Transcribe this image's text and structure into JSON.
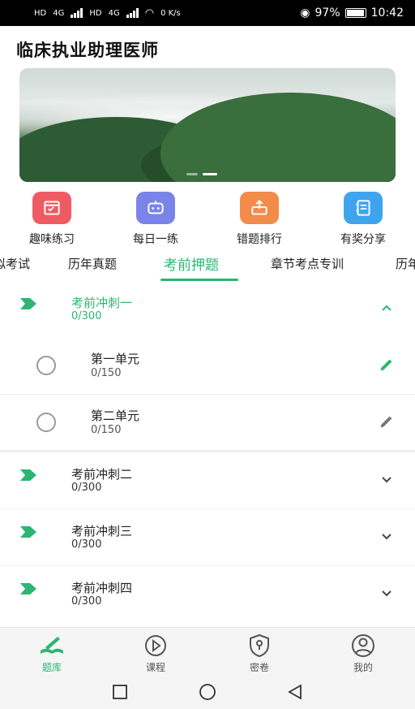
{
  "status": {
    "left": [
      "HD",
      "4G",
      "HD",
      "4G",
      "0 K/s"
    ],
    "battery": "97%",
    "time": "10:42"
  },
  "app_title": "临床执业助理医师",
  "quick": [
    {
      "label": "趣味练习",
      "icon": "calendar-icon",
      "color": "#ef5b63"
    },
    {
      "label": "每日一练",
      "icon": "robot-icon",
      "color": "#7a84e8"
    },
    {
      "label": "错题排行",
      "icon": "upload-box-icon",
      "color": "#f38b4b"
    },
    {
      "label": "有奖分享",
      "icon": "notebook-icon",
      "color": "#3ea4ee"
    }
  ],
  "tabs": [
    "拟考试",
    "历年真题",
    "考前押题",
    "章节考点专训",
    "历年"
  ],
  "active_tab": "考前押题",
  "sections": [
    {
      "title": "考前冲刺一",
      "count": "0/300",
      "expanded": true,
      "units": [
        {
          "title": "第一单元",
          "count": "0/150"
        },
        {
          "title": "第二单元",
          "count": "0/150"
        }
      ]
    },
    {
      "title": "考前冲刺二",
      "count": "0/300",
      "expanded": false
    },
    {
      "title": "考前冲刺三",
      "count": "0/300",
      "expanded": false
    },
    {
      "title": "考前冲刺四",
      "count": "0/300",
      "expanded": false
    }
  ],
  "bottom_nav": [
    {
      "label": "题库",
      "icon": "book-pen-icon",
      "active": true
    },
    {
      "label": "课程",
      "icon": "play-circle-icon",
      "active": false
    },
    {
      "label": "密卷",
      "icon": "shield-lock-icon",
      "active": false
    },
    {
      "label": "我的",
      "icon": "user-circle-icon",
      "active": false
    }
  ],
  "colors": {
    "accent": "#2bb673"
  }
}
